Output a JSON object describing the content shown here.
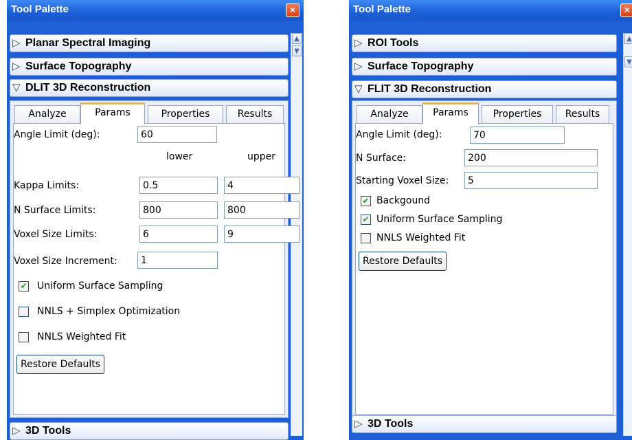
{
  "left_palette": {
    "title": "Tool Palette",
    "close_glyph": "×",
    "sections": [
      {
        "arrow": "▷",
        "label": "Planar Spectral Imaging"
      },
      {
        "arrow": "▷",
        "label": "Surface Topography"
      },
      {
        "arrow": "▽",
        "label": "DLIT 3D Reconstruction"
      }
    ],
    "tabs": [
      "Analyze",
      "Params",
      "Properties",
      "Results"
    ],
    "active_tab": "Params",
    "angle_limit": {
      "label": "Angle Limit (deg):",
      "value": "60"
    },
    "col_lower": "lower",
    "col_upper": "upper",
    "kappa": {
      "label": "Kappa Limits:",
      "lower": "0.5",
      "upper": "4"
    },
    "n_surface": {
      "label": "N Surface Limits:",
      "lower": "800",
      "upper": "800"
    },
    "voxel_size": {
      "label": "Voxel Size Limits:",
      "lower": "6",
      "upper": "9"
    },
    "voxel_increment": {
      "label": "Voxel Size Increment:",
      "value": "1"
    },
    "checkboxes": [
      {
        "label": "Uniform Surface Sampling",
        "checked": true
      },
      {
        "label": "NNLS + Simplex Optimization",
        "checked": false
      },
      {
        "label": "NNLS Weighted Fit",
        "checked": false
      }
    ],
    "restore_label": "Restore Defaults",
    "bottom_section": {
      "arrow": "▷",
      "label": "3D Tools"
    }
  },
  "right_palette": {
    "title": "Tool Palette",
    "close_glyph": "×",
    "sections": [
      {
        "arrow": "▷",
        "label": "ROI Tools"
      },
      {
        "arrow": "▷",
        "label": "Surface Topography"
      },
      {
        "arrow": "▽",
        "label": "FLIT 3D Reconstruction"
      }
    ],
    "tabs": [
      "Analyze",
      "Params",
      "Properties",
      "Results"
    ],
    "active_tab": "Params",
    "angle_limit": {
      "label": "Angle Limit (deg):",
      "value": "70"
    },
    "n_surface": {
      "label": "N Surface:",
      "value": "200"
    },
    "start_voxel": {
      "label": "Starting Voxel Size:",
      "value": "5"
    },
    "checkboxes": [
      {
        "label": "Backgound",
        "checked": true
      },
      {
        "label": "Uniform Surface Sampling",
        "checked": true
      },
      {
        "label": "NNLS Weighted Fit",
        "checked": false
      }
    ],
    "restore_label": "Restore Defaults",
    "bottom_section": {
      "arrow": "▷",
      "label": "3D Tools"
    }
  },
  "icons": {
    "close": "close-icon",
    "scroll_up": "scroll-up-icon",
    "scroll_down": "scroll-down-icon",
    "expand": "triangle-right-icon",
    "collapse": "triangle-down-icon",
    "check": "checkmark-icon"
  },
  "colors": {
    "title_bar": "#1f5fd6",
    "close_button": "#d9400f",
    "active_tab_accent": "#f3b33a",
    "checkmark": "#21a121"
  }
}
